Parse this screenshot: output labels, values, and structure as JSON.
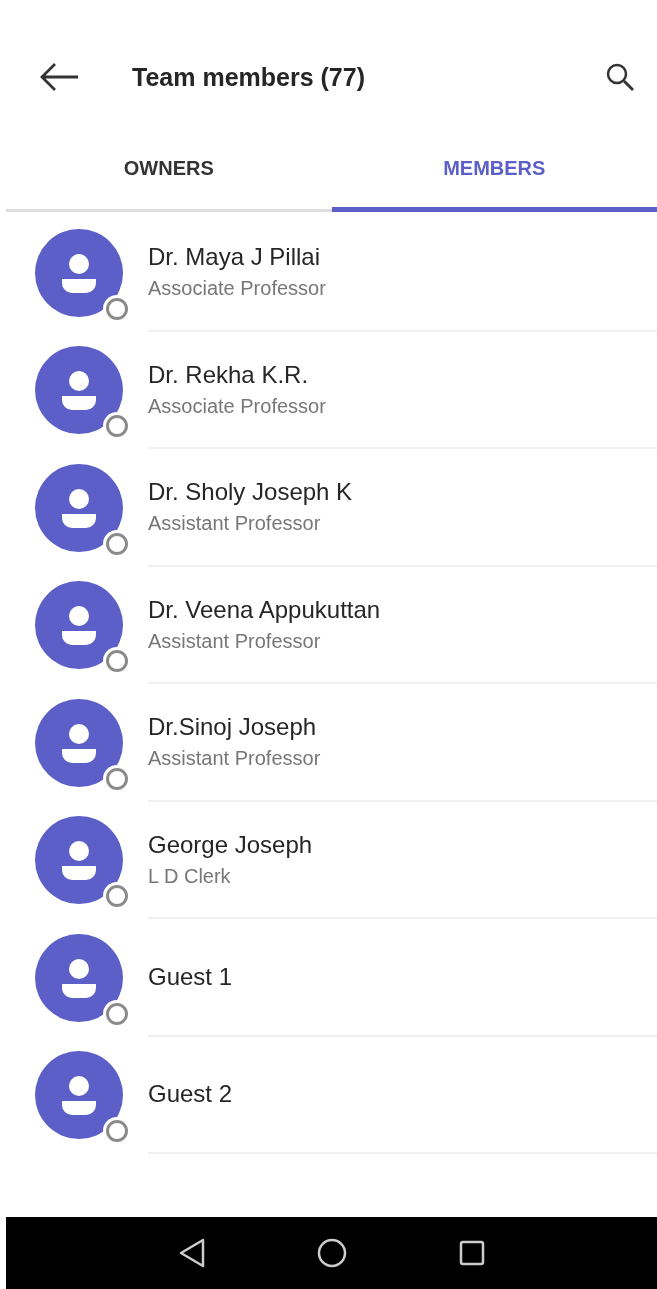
{
  "header": {
    "title": "Team members (77)"
  },
  "tabs": [
    {
      "label": "OWNERS",
      "selected": false
    },
    {
      "label": "MEMBERS",
      "selected": true
    }
  ],
  "members": [
    {
      "name": "Dr. Maya J Pillai",
      "role": "Associate Professor"
    },
    {
      "name": "Dr. Rekha K.R.",
      "role": "Associate Professor"
    },
    {
      "name": "Dr. Sholy Joseph K",
      "role": "Assistant Professor"
    },
    {
      "name": "Dr. Veena Appukuttan",
      "role": "Assistant Professor"
    },
    {
      "name": "Dr.Sinoj Joseph",
      "role": "Assistant Professor"
    },
    {
      "name": "George Joseph",
      "role": "L D Clerk"
    },
    {
      "name": "Guest 1"
    },
    {
      "name": "Guest 2"
    }
  ]
}
